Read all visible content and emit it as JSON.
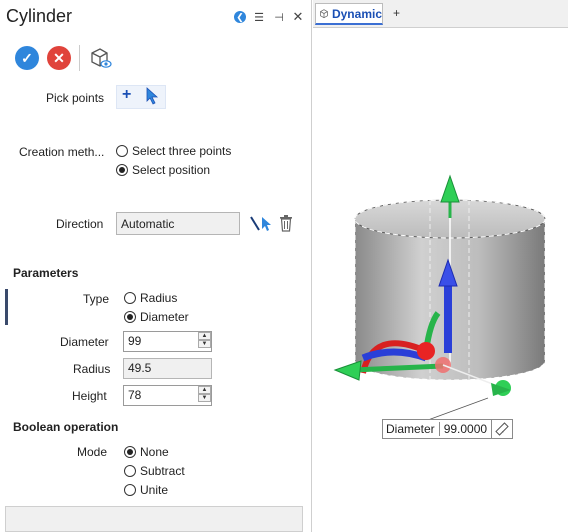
{
  "panel": {
    "title": "Cylinder",
    "pick_points_label": "Pick points",
    "creation_method_label": "Creation meth...",
    "creation_options": [
      "Select three points",
      "Select position"
    ],
    "direction_label": "Direction",
    "direction_value": "Automatic",
    "parameters_title": "Parameters",
    "type_label": "Type",
    "type_options": [
      "Radius",
      "Diameter"
    ],
    "diameter_label": "Diameter",
    "diameter_value": "99",
    "radius_label": "Radius",
    "radius_value": "49.5",
    "height_label": "Height",
    "height_value": "78",
    "boolean_title": "Boolean operation",
    "mode_label": "Mode",
    "mode_options": [
      "None",
      "Subtract",
      "Unite"
    ]
  },
  "viewport": {
    "tab_label": "Dynamic",
    "add_tab": "+",
    "dim_name": "Diameter",
    "dim_value": "99.0000"
  },
  "colors": {
    "accept": "#2f86dc",
    "cancel": "#e0433b",
    "accent": "#3b6fd3"
  }
}
